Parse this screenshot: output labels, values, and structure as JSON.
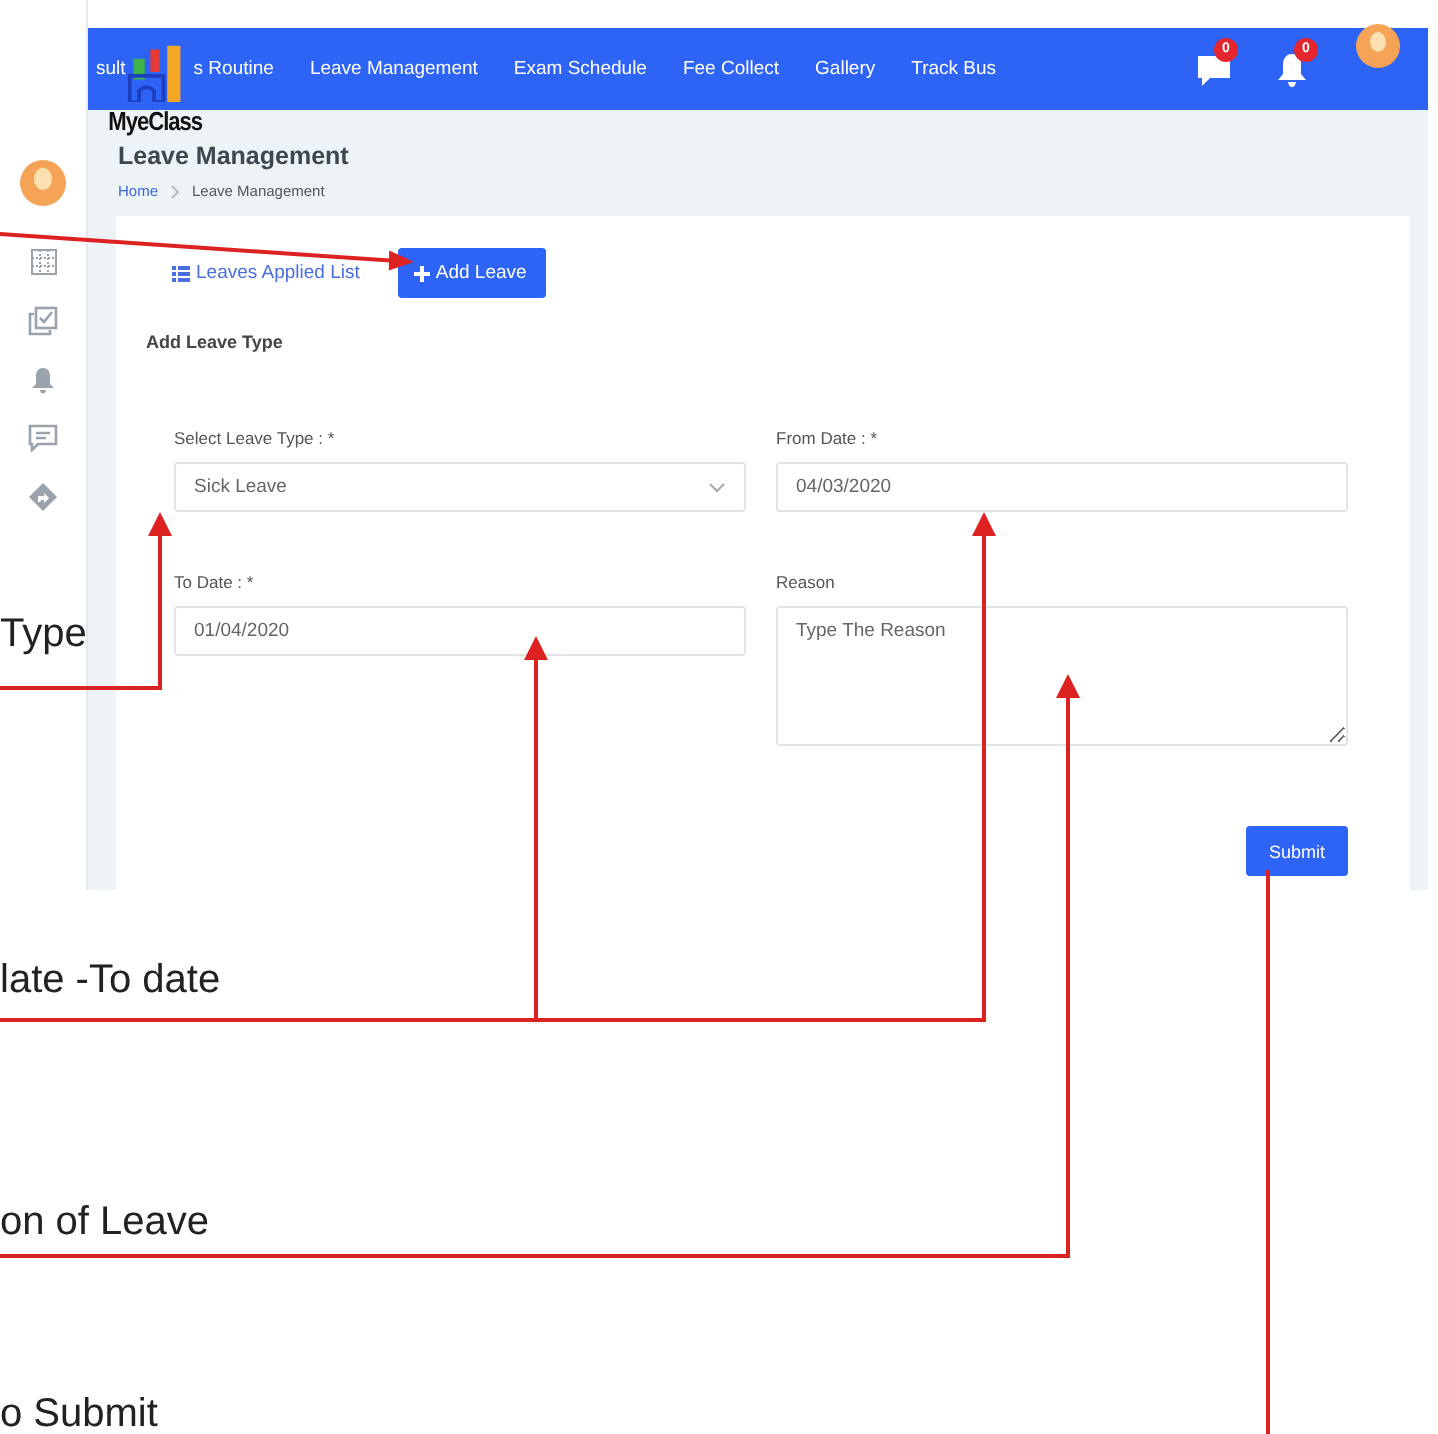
{
  "navbar": {
    "logo": "MyeClass",
    "items": [
      {
        "label": "sult"
      },
      {
        "label": "s Routine"
      },
      {
        "label": "Leave Management"
      },
      {
        "label": "Exam Schedule"
      },
      {
        "label": "Fee Collect"
      },
      {
        "label": "Gallery"
      },
      {
        "label": "Track Bus"
      }
    ],
    "notifications": [
      {
        "kind": "chat",
        "count": "0"
      },
      {
        "kind": "bell",
        "count": "0"
      }
    ]
  },
  "page": {
    "title": "Leave Management",
    "breadcrumb": [
      "Home",
      "Leave Management"
    ]
  },
  "tabs": [
    {
      "label": "Leaves Applied List",
      "selected": false
    },
    {
      "label": "Add Leave",
      "selected": true
    }
  ],
  "form": {
    "title": "Add Leave Type",
    "fields": [
      {
        "kind": "select",
        "label": "Select Leave Type : *",
        "value": "Sick Leave"
      },
      {
        "kind": "text",
        "label": "From Date : *",
        "value": "04/03/2020"
      },
      {
        "kind": "text",
        "label": "To Date : *",
        "value": "01/04/2020"
      },
      {
        "kind": "textarea",
        "label": "Reason",
        "value": "Type The Reason"
      }
    ],
    "submit": "Submit"
  },
  "annotations": [
    {
      "text": "Type"
    },
    {
      "text": "late -To date"
    },
    {
      "text": "on of Leave"
    },
    {
      "text": "o Submit"
    }
  ]
}
